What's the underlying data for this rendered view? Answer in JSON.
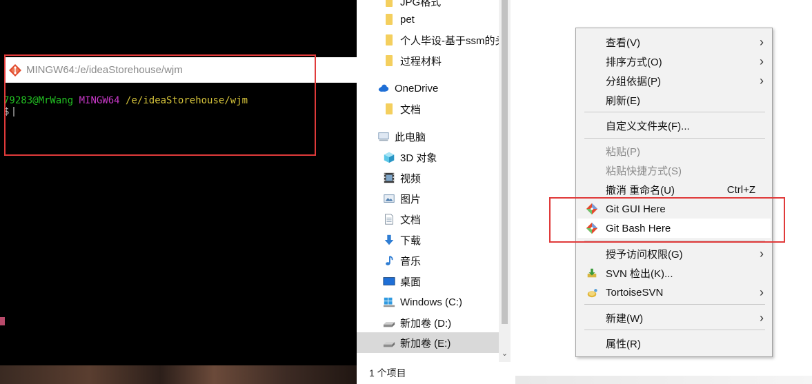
{
  "terminal": {
    "title": "MINGW64:/e/ideaStorehouse/wjm",
    "prompt_user": "79283@MrWang",
    "prompt_system": "MINGW64",
    "prompt_path": "/e/ideaStorehouse/wjm",
    "prompt_symbol": "$"
  },
  "explorer": {
    "nav_items": [
      {
        "label": "JPG格式",
        "icon": "folder-icon"
      },
      {
        "label": "pet",
        "icon": "folder-icon"
      },
      {
        "label": "个人毕设-基于ssm的头",
        "icon": "folder-icon"
      },
      {
        "label": "过程材料",
        "icon": "folder-icon"
      },
      {
        "label": "OneDrive",
        "icon": "onedrive-icon"
      },
      {
        "label": "文档",
        "icon": "folder-icon"
      },
      {
        "label": "此电脑",
        "icon": "computer-icon"
      },
      {
        "label": "3D 对象",
        "icon": "3d-objects-icon"
      },
      {
        "label": "视频",
        "icon": "video-icon"
      },
      {
        "label": "图片",
        "icon": "pictures-icon"
      },
      {
        "label": "文档",
        "icon": "documents-icon"
      },
      {
        "label": "下载",
        "icon": "download-icon"
      },
      {
        "label": "音乐",
        "icon": "music-icon"
      },
      {
        "label": "桌面",
        "icon": "desktop-icon"
      },
      {
        "label": "Windows (C:)",
        "icon": "windows-drive-icon"
      },
      {
        "label": "新加卷 (D:)",
        "icon": "drive-icon"
      },
      {
        "label": "新加卷 (E:)",
        "icon": "drive-icon"
      }
    ],
    "status": "1 个项目"
  },
  "context_menu": {
    "items": [
      {
        "label": "查看(V)",
        "submenu": true
      },
      {
        "label": "排序方式(O)",
        "submenu": true
      },
      {
        "label": "分组依据(P)",
        "submenu": true
      },
      {
        "label": "刷新(E)"
      },
      {
        "label": "自定义文件夹(F)..."
      },
      {
        "label": "粘贴(P)",
        "disabled": true
      },
      {
        "label": "粘贴快捷方式(S)",
        "disabled": true
      },
      {
        "label": "撤消 重命名(U)",
        "shortcut": "Ctrl+Z"
      },
      {
        "label": "Git GUI Here",
        "icon": "git-icon"
      },
      {
        "label": "Git Bash Here",
        "icon": "git-icon"
      },
      {
        "label": "授予访问权限(G)",
        "submenu": true
      },
      {
        "label": "SVN 检出(K)...",
        "icon": "svn-checkout-icon"
      },
      {
        "label": "TortoiseSVN",
        "icon": "tortoisesvn-icon",
        "submenu": true
      },
      {
        "label": "新建(W)",
        "submenu": true
      },
      {
        "label": "属性(R)"
      }
    ],
    "submenu_arrow": "›"
  },
  "colors": {
    "highlight_border": "#e03a3a",
    "terminal_bg": "#000000",
    "prompt_green": "#22c022",
    "prompt_magenta": "#c838c8",
    "prompt_yellow": "#d4c23a",
    "menu_bg": "#f2f2f2"
  }
}
